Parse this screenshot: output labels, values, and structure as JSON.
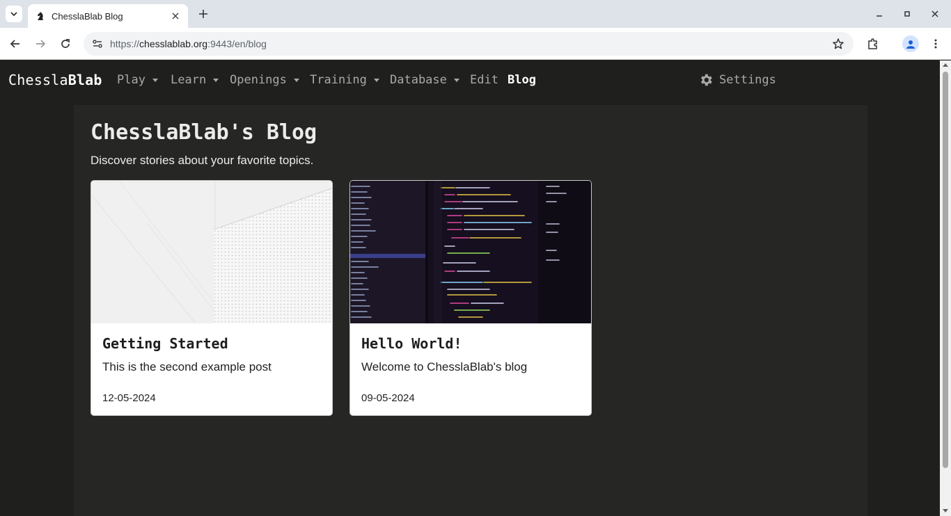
{
  "browser": {
    "tab_title": "ChesslaBlab Blog",
    "url_scheme": "https://",
    "url_host": "chesslablab.org",
    "url_rest": ":9443/en/blog"
  },
  "nav": {
    "brand_light": "Chessla",
    "brand_bold": "Blab",
    "items": [
      {
        "label": "Play",
        "dropdown": true
      },
      {
        "label": "Learn",
        "dropdown": true
      },
      {
        "label": "Openings",
        "dropdown": true
      },
      {
        "label": "Training",
        "dropdown": true
      },
      {
        "label": "Database",
        "dropdown": true
      },
      {
        "label": "Edit",
        "dropdown": false
      },
      {
        "label": "Blog",
        "dropdown": false,
        "active": true
      }
    ],
    "settings_label": "Settings"
  },
  "blog": {
    "title": "ChesslaBlab's Blog",
    "subtitle": "Discover stories about your favorite topics.",
    "posts": [
      {
        "title": "Getting Started",
        "excerpt": "This is the second example post",
        "date": "12-05-2024",
        "image": "white-architecture-photo"
      },
      {
        "title": "Hello World!",
        "excerpt": "Welcome to ChesslaBlab's blog",
        "date": "09-05-2024",
        "image": "code-editor-photo"
      }
    ]
  },
  "colors": {
    "page_bg": "#1f1f1d",
    "container_bg": "#262624",
    "nav_text": "#a9a9a9",
    "active_text": "#ffffff"
  }
}
